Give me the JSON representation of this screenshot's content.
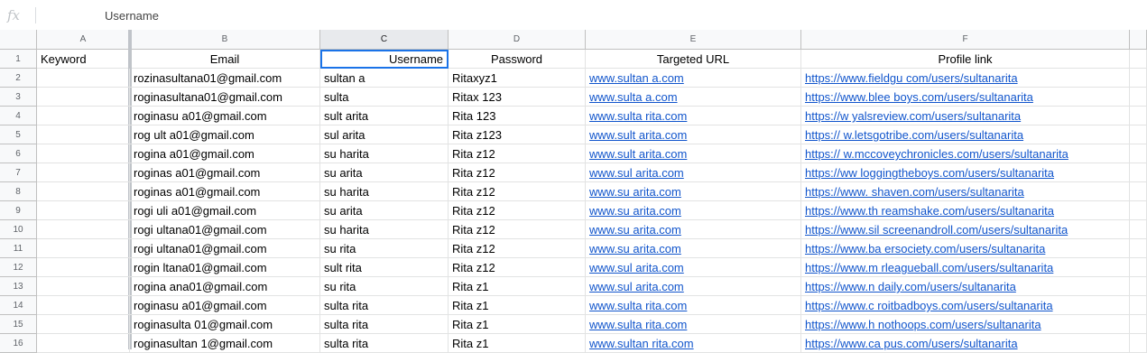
{
  "formula_bar": {
    "fx_label": "fx",
    "value": "Username"
  },
  "columns": [
    "A",
    "B",
    "C",
    "D",
    "E",
    "F"
  ],
  "selected_column": "C",
  "header_row": {
    "num": "1",
    "cells": [
      "Keyword",
      "Email",
      "Username",
      "Password",
      "Targeted URL",
      "Profile link"
    ]
  },
  "rows": [
    {
      "num": "2",
      "a": "",
      "b": "rozinasultana01@gmail.com",
      "c": "sultan  a",
      "d": "Ritaxyz1",
      "e": "www.sultan    a.com",
      "f": "https://www.fieldgu   com/users/sultanarita"
    },
    {
      "num": "3",
      "a": "",
      "b": "roginasultana01@gmail.com",
      "c": "sulta",
      "d": "Ritax   123",
      "e": "www.sulta     a.com",
      "f": "https://www.blee    boys.com/users/sultanarita"
    },
    {
      "num": "4",
      "a": "",
      "b": "roginasu   a01@gmail.com",
      "c": "sult   arita",
      "d": "Rita   123",
      "e": "www.sulta    rita.com",
      "f": "https://w     yalsreview.com/users/sultanarita"
    },
    {
      "num": "5",
      "a": "",
      "b": "rog    ult   a01@gmail.com",
      "c": "sul    arita",
      "d": "Rita   z123",
      "e": "www.sult     arita.com",
      "f": "https://     w.letsgotribe.com/users/sultanarita"
    },
    {
      "num": "6",
      "a": "",
      "b": "rogina   a01@gmail.com",
      "c": "su    harita",
      "d": "Rita   z12",
      "e": "www.sult     arita.com",
      "f": "https://     w.mccoveychronicles.com/users/sultanarita"
    },
    {
      "num": "7",
      "a": "",
      "b": "roginas   a01@gmail.com",
      "c": "su    arita",
      "d": "Rita   z12",
      "e": "www.sul     arita.com",
      "f": "https://ww    loggingtheboys.com/users/sultanarita"
    },
    {
      "num": "8",
      "a": "",
      "b": "roginas     a01@gmail.com",
      "c": "su    harita",
      "d": "Rita   z12",
      "e": "www.su     arita.com",
      "f": "https://www.    shaven.com/users/sultanarita"
    },
    {
      "num": "9",
      "a": "",
      "b": "rogi   uli   a01@gmail.com",
      "c": "su    arita",
      "d": "Rita   z12",
      "e": "www.su     arita.com",
      "f": "https://www.th    reamshake.com/users/sultanarita"
    },
    {
      "num": "10",
      "a": "",
      "b": "rogi    ultana01@gmail.com",
      "c": "su    harita",
      "d": "Rita   z12",
      "e": "www.su     arita.com",
      "f": "https://www.sil     screenandroll.com/users/sultanarita"
    },
    {
      "num": "11",
      "a": "",
      "b": "rogi    ultana01@gmail.com",
      "c": "su    rita",
      "d": "Rita   z12",
      "e": "www.su     arita.com",
      "f": "https://www.ba    ersociety.com/users/sultanarita"
    },
    {
      "num": "12",
      "a": "",
      "b": "rogin    ltana01@gmail.com",
      "c": "sult   rita",
      "d": "Rita   z12",
      "e": "www.sul     arita.com",
      "f": "https://www.m    rleagueball.com/users/sultanarita"
    },
    {
      "num": "13",
      "a": "",
      "b": "rogina    ana01@gmail.com",
      "c": "su    rita",
      "d": "Rita   z1",
      "e": "www.sul     arita.com",
      "f": "https://www.n    daily.com/users/sultanarita"
    },
    {
      "num": "14",
      "a": "",
      "b": "roginasu   a01@gmail.com",
      "c": "sulta   rita",
      "d": "Rita   z1",
      "e": "www.sulta     rita.com",
      "f": "https://www.c    roitbadboys.com/users/sultanarita"
    },
    {
      "num": "15",
      "a": "",
      "b": "roginasulta    01@gmail.com",
      "c": "sulta   rita",
      "d": "Rita   z1",
      "e": "www.sulta     rita.com",
      "f": "https://www.h    nothoops.com/users/sultanarita"
    },
    {
      "num": "16",
      "a": "",
      "b": "roginasultan   1@gmail.com",
      "c": "sulta   rita",
      "d": "Rita   z1",
      "e": "www.sultan     rita.com",
      "f": "https://www.ca     pus.com/users/sultanarita"
    }
  ]
}
